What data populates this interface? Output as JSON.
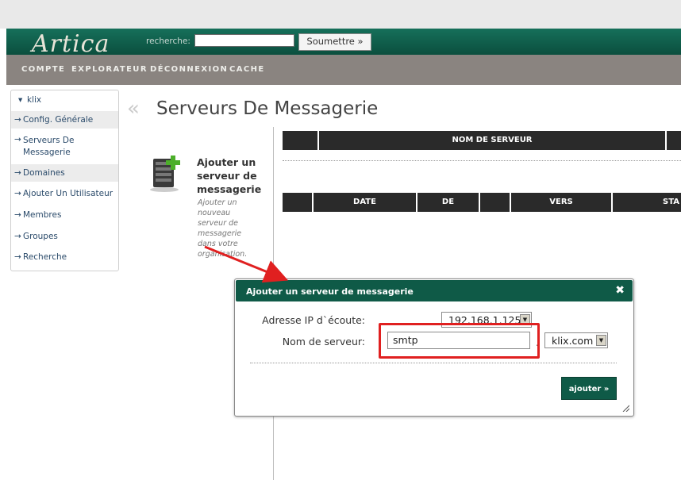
{
  "header": {
    "logo": "Artica",
    "search_label": "recherche:",
    "search_value": "",
    "search_button": "Soumettre »"
  },
  "nav": [
    "COMPTE",
    "EXPLORATEUR",
    "DÉCONNEXION",
    "CACHE"
  ],
  "sidebar": {
    "root": "klix",
    "items": [
      {
        "label": "Config. Générale"
      },
      {
        "label": "Serveurs De Messagerie"
      },
      {
        "label": "Domaines"
      },
      {
        "label": "Ajouter Un Utilisateur"
      },
      {
        "label": "Membres"
      },
      {
        "label": "Groupes"
      },
      {
        "label": "Recherche"
      }
    ]
  },
  "page": {
    "title": "Serveurs De Messagerie",
    "add_title": "Ajouter un serveur de messagerie",
    "add_desc": "Ajouter un nouveau serveur de messagerie dans votre organisation."
  },
  "table1": {
    "columns": [
      "",
      "NOM DE SERVEUR",
      ""
    ]
  },
  "table2": {
    "columns": [
      "",
      "DATE",
      "DE",
      "",
      "VERS",
      "STA"
    ]
  },
  "dialog": {
    "title": "Ajouter un serveur de messagerie",
    "close": "✖",
    "ip_label": "Adresse IP d`écoute:",
    "ip_value": "192.168.1.125",
    "name_label": "Nom de serveur:",
    "name_value": "smtp",
    "dot": ".",
    "domain_value": "klix.com",
    "submit": "ajouter »"
  },
  "colors": {
    "header_green": "#0e5c49",
    "nav_gray": "#8a8480",
    "highlight_red": "#e02020"
  }
}
